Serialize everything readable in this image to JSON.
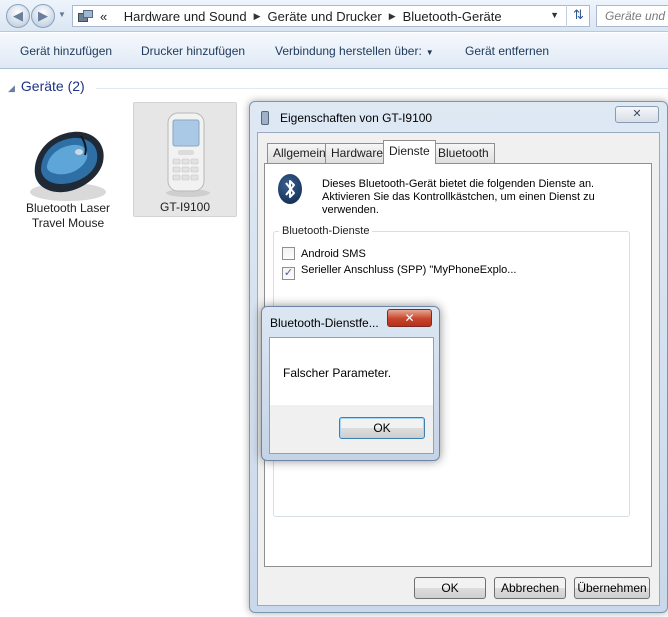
{
  "address_bar": {
    "breadcrumb": [
      "Hardware und Sound",
      "Geräte und Drucker",
      "Bluetooth-Geräte"
    ],
    "overflow_glyph": "«",
    "search_placeholder": "Geräte und"
  },
  "toolbar": {
    "add_device": "Gerät hinzufügen",
    "add_printer": "Drucker hinzufügen",
    "connect_via": "Verbindung herstellen über:",
    "remove_device": "Gerät entfernen"
  },
  "devices_group": {
    "header": "Geräte (2)",
    "items": [
      {
        "label_line1": "Bluetooth Laser",
        "label_line2": "Travel Mouse"
      },
      {
        "label_line1": "GT-I9100",
        "label_line2": ""
      }
    ]
  },
  "properties_window": {
    "title": "Eigenschaften von GT-I9100",
    "close_glyph": "✕",
    "tabs": [
      "Allgemein",
      "Hardware",
      "Dienste",
      "Bluetooth"
    ],
    "active_tab": "Dienste",
    "description": "Dieses Bluetooth-Gerät bietet die folgenden Dienste an. Aktivieren Sie das Kontrollkästchen, um einen Dienst zu verwenden.",
    "services_group_label": "Bluetooth-Dienste",
    "services": [
      {
        "label": "Android SMS",
        "checked": false
      },
      {
        "label": "Serieller Anschluss (SPP) \"MyPhoneExplo...",
        "checked": true
      }
    ],
    "buttons": {
      "ok": "OK",
      "cancel": "Abbrechen",
      "apply": "Übernehmen"
    }
  },
  "error_dialog": {
    "title": "Bluetooth-Dienstfe...",
    "close_glyph": "✕",
    "message": "Falscher Parameter.",
    "ok": "OK"
  },
  "colors": {
    "accent_header": "#1e3287",
    "toolbar_text": "#1e395b",
    "close_red": "#c6452c"
  }
}
